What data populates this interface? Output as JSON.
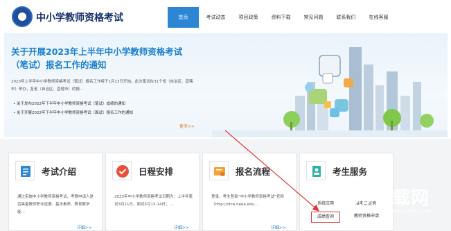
{
  "header": {
    "site_title": "中小学教师资格考试",
    "nav": [
      "首页",
      "考试动态",
      "项目政策",
      "资料下载",
      "常见问题",
      "联系我们",
      "在线客服"
    ]
  },
  "hero": {
    "title": "关于开展2023年上半年中小学教师资格考试（笔试）报名工作的通知",
    "description": "2023年上半年中小学教师资格考试（笔试）报名工作将于1月13日开始。此次笔试在31个省（自治区、直辖市）举办，各省（自治区、直辖市）的报…",
    "links": [
      "关于发布2022年下半年中小学教师资格考试（笔试）成绩的通知",
      "关于开展2022年下半年中小学教师资格考试（面试）报名工作的通知"
    ],
    "more": "更多>>"
  },
  "cards": [
    {
      "title": "考试介绍",
      "icon": "document-icon",
      "text": "通过实施中小学教师资格考试，考察申请人是否具备教师职业道德、基本素养、教育教学能…",
      "more": "详细>>"
    },
    {
      "title": "日程安排",
      "icon": "checkmark-icon",
      "text": "2023年中小学教师资格考试日期为：上半年笔试3月11日，面试5月13-14日；…",
      "more": "详细>>"
    },
    {
      "title": "报名流程",
      "icon": "certificate-icon",
      "text": "登录、考生登录“中小学教师资格考试”官网（http://ntce.neea.edu…",
      "more": "详细>>"
    },
    {
      "title": "考生服务",
      "icon": "id-card-icon",
      "text": "",
      "more": ""
    }
  ],
  "services": {
    "btn1": "系统应用",
    "btn2": "准考证查询",
    "btn3": "成绩查询",
    "btn4": "教师资格申请"
  },
  "watermark": {
    "text": "189下载网",
    "url": "www.189xz.com"
  },
  "colors": {
    "accent": "#2c86d3",
    "title_blue": "#1a7fd0",
    "highlight": "#e03a3a",
    "more": "#e07a1e"
  }
}
